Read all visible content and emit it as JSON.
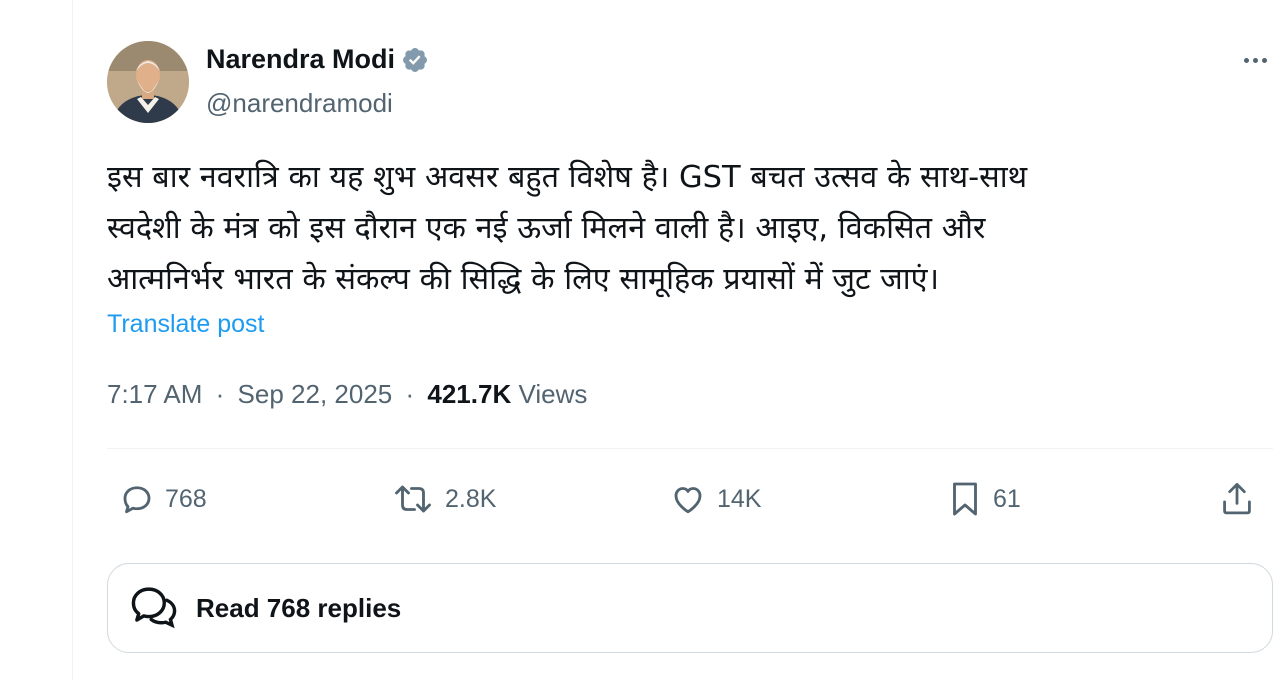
{
  "author": {
    "name": "Narendra Modi",
    "handle": "@narendramodi",
    "verified_color": "#829aab"
  },
  "tweet": {
    "lines": [
      "इस बार नवरात्रि का यह शुभ अवसर बहुत विशेष है। GST बचत उत्सव के साथ-साथ",
      "स्वदेशी के मंत्र को इस दौरान एक नई ऊर्जा मिलने वाली है। आइए, विकसित और",
      "आत्मनिर्भर भारत के संकल्प की सिद्धि के लिए सामूहिक प्रयासों में जुट जाएं।"
    ],
    "translate_label": "Translate post",
    "time": "7:17 AM",
    "date": "Sep 22, 2025",
    "views_count": "421.7K",
    "views_label": "Views",
    "separator": "·"
  },
  "actions": {
    "reply_count": "768",
    "repost_count": "2.8K",
    "like_count": "14K",
    "bookmark_count": "61"
  },
  "read_replies_label": "Read 768 replies",
  "colors": {
    "text": "#0f1419",
    "secondary": "#536471",
    "link": "#1d9bf0",
    "border": "#cfd9de"
  },
  "icons": [
    "verified-badge-icon",
    "more-icon",
    "reply-icon",
    "repost-icon",
    "like-icon",
    "bookmark-icon",
    "share-icon",
    "replies-bubble-icon"
  ]
}
